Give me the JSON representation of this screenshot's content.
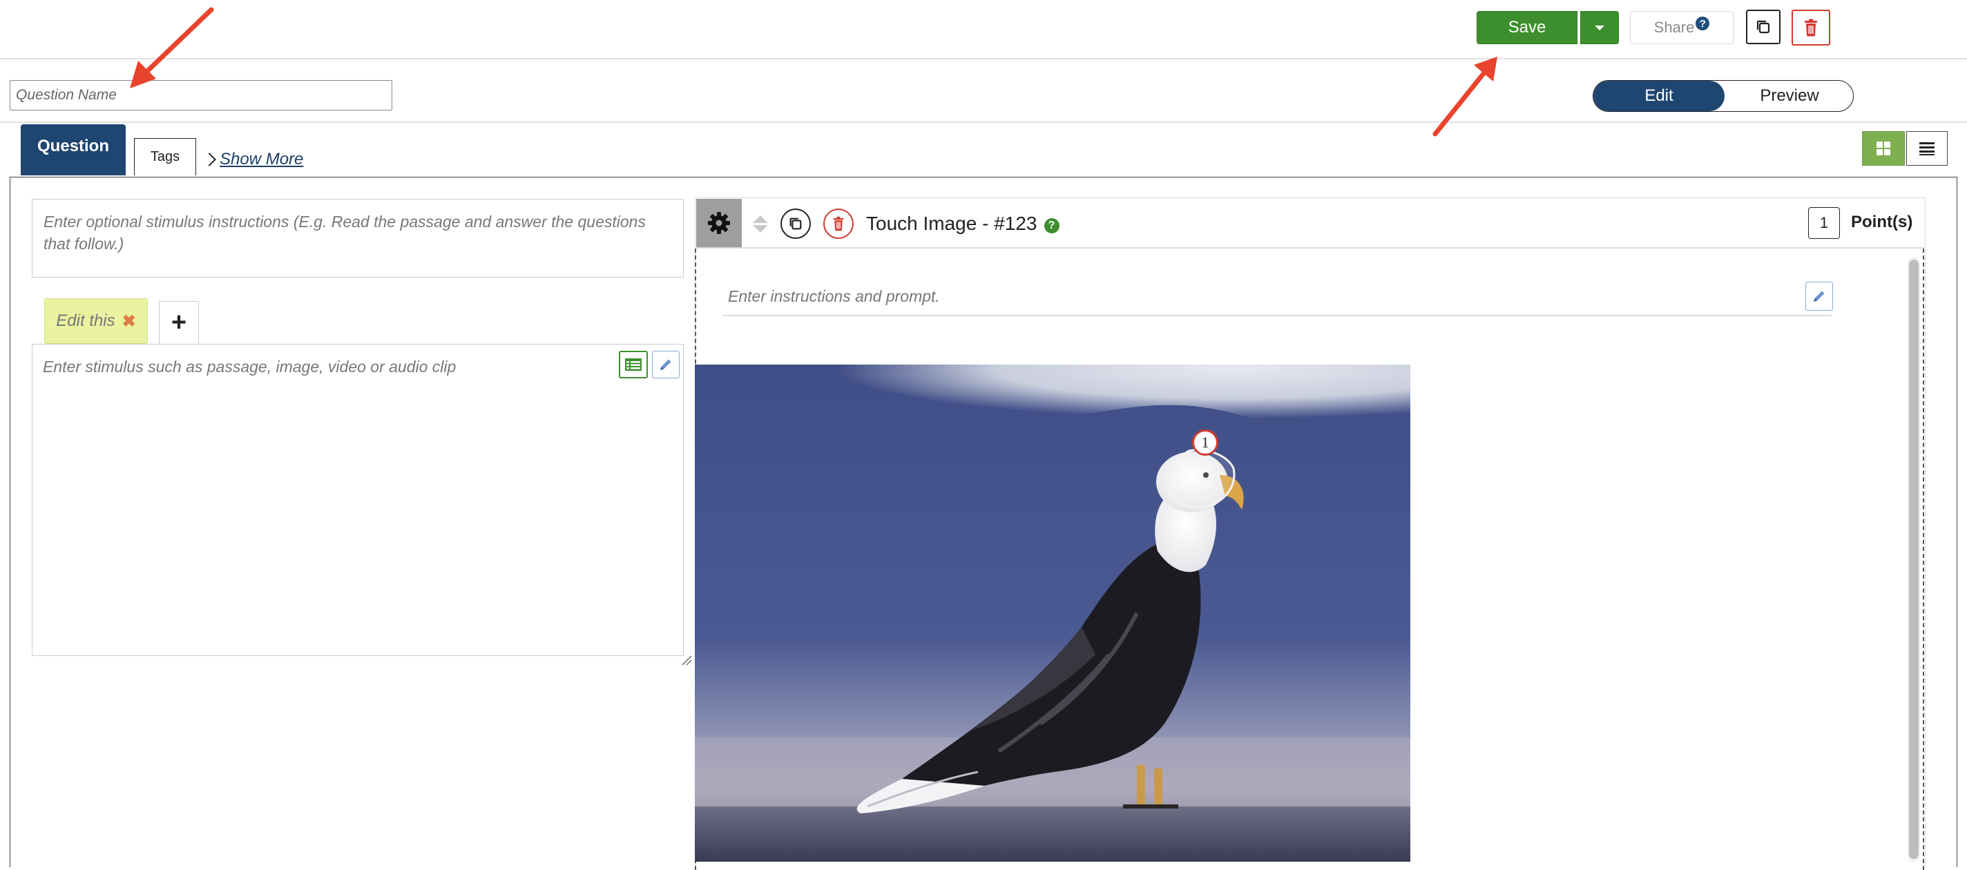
{
  "toolbar": {
    "save_label": "Save",
    "share_label": "Share",
    "share_help": "?"
  },
  "question_name": {
    "placeholder": "Question Name"
  },
  "mode_toggle": {
    "edit_label": "Edit",
    "preview_label": "Preview",
    "active": "Edit"
  },
  "tabs": [
    {
      "label": "Question",
      "active": true
    },
    {
      "label": "Tags",
      "active": false
    }
  ],
  "show_more_label": "Show More",
  "stimulus": {
    "instructions_placeholder": "Enter optional stimulus instructions (E.g. Read the passage and answer the questions that follow.)",
    "chip_label": "Edit this",
    "chip_close": "✖",
    "add_label": "+",
    "content_placeholder": "Enter stimulus such as passage, image, video or audio clip"
  },
  "question": {
    "title": "Touch Image - #123",
    "help": "?",
    "points_value": "1",
    "points_label": "Point(s)",
    "prompt_placeholder": "Enter instructions and prompt.",
    "hotspot_number": "1"
  },
  "colors": {
    "primary_navy": "#1f4670",
    "save_green": "#3d8f2d",
    "danger_red": "#d23a2f",
    "chip_yellow": "#e9f3a0",
    "grid_btn_green": "#7fb050",
    "annotation_arrow": "#e8432c"
  },
  "icons": {
    "copy": "copy-icon",
    "trash": "trash-icon",
    "gear": "gear-icon",
    "grid": "grid-view-icon",
    "list": "list-view-icon",
    "pencil": "pencil-icon",
    "table": "table-icon"
  }
}
